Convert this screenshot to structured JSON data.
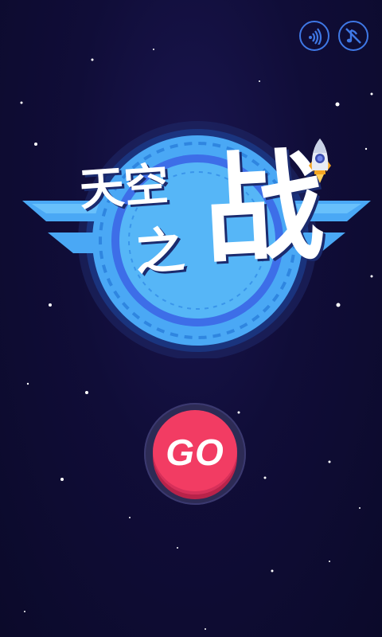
{
  "app": {
    "title_chars": [
      "天空",
      "之",
      "战"
    ],
    "go_label": "GO"
  },
  "toolbar": {
    "sound_icon": "sound-waves-icon",
    "music_icon": "music-off-icon"
  },
  "colors": {
    "background": "#0d0b2e",
    "emblem_blue": "#4aa8f5",
    "emblem_light": "#7dd0ff",
    "go_red": "#f23c63",
    "icon_blue": "#3f78e6"
  }
}
